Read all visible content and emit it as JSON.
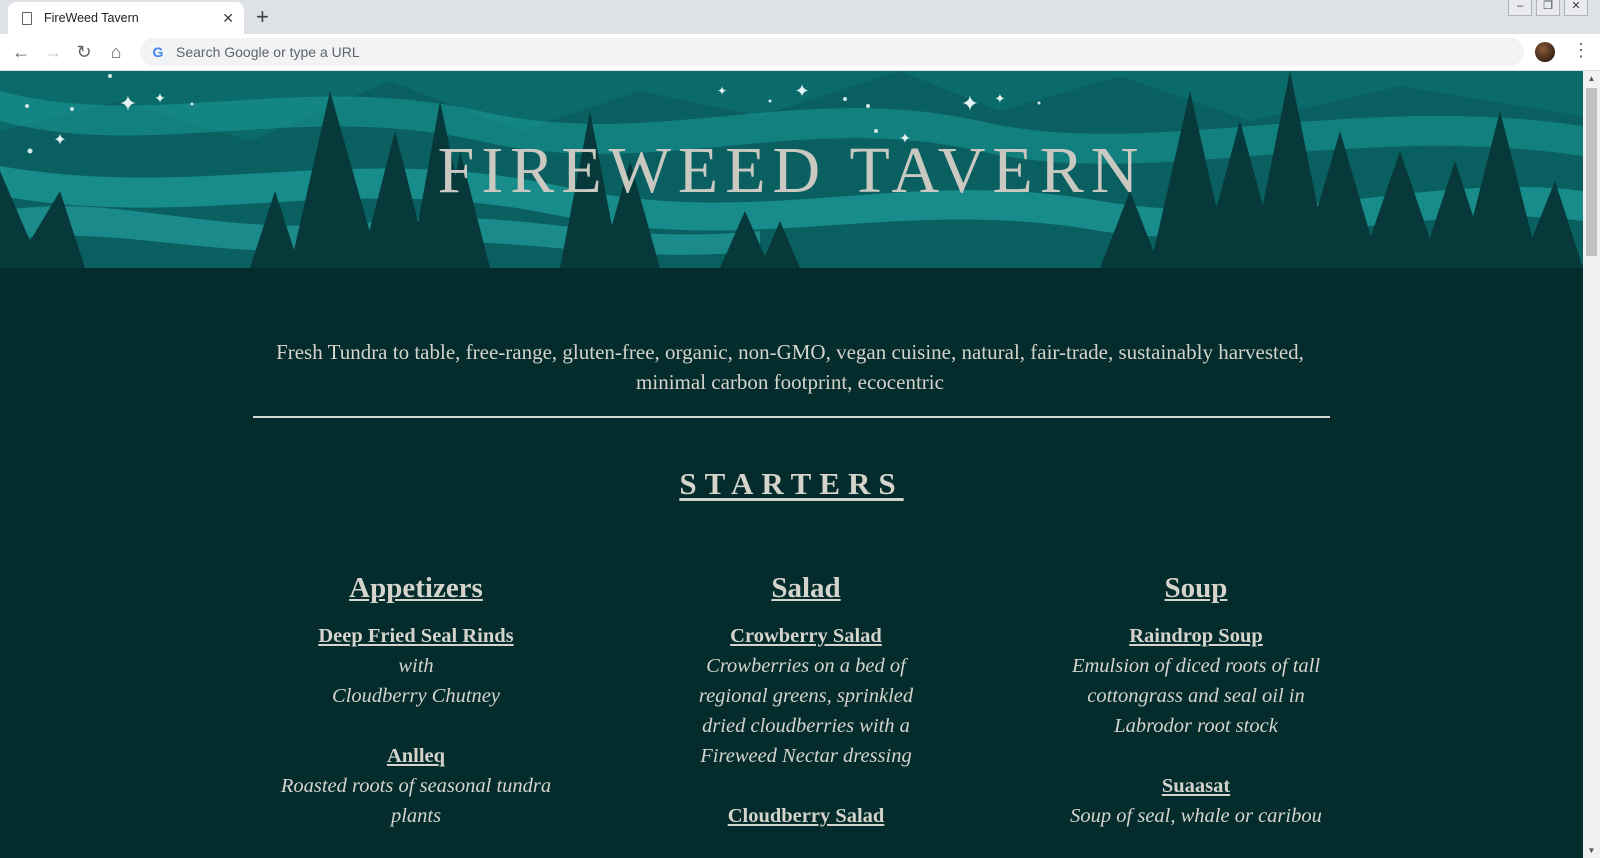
{
  "browser": {
    "tab_title": "FireWeed Tavern",
    "tab_close": "✕",
    "new_tab": "+",
    "omnibox_placeholder": "Search Google or type a URL",
    "window_controls": {
      "minimize": "–",
      "restore": "❐",
      "close": "✕"
    }
  },
  "site": {
    "title": "FIREWEED TAVERN",
    "tagline": "Fresh Tundra to table, free-range, gluten-free, organic, non-GMO, vegan cuisine, natural, fair-trade, sustainably harvested, minimal carbon footprint, ecocentric"
  },
  "menu": {
    "section_title": "STARTERS",
    "columns": [
      {
        "heading": "Appetizers",
        "items": [
          {
            "name": "Deep Fried Seal Rinds",
            "desc_line1": "with",
            "desc_line2": "Cloudberry Chutney"
          },
          {
            "name": "Anlleq",
            "desc": "Roasted roots of seasonal tundra plants"
          }
        ]
      },
      {
        "heading": "Salad",
        "items": [
          {
            "name": "Crowberry Salad",
            "desc": "Crowberries on a bed of regional greens, sprinkled dried cloudberries with a Fireweed Nectar dressing"
          },
          {
            "name": "Cloudberry Salad"
          }
        ]
      },
      {
        "heading": "Soup",
        "items": [
          {
            "name": "Raindrop Soup",
            "desc": "Emulsion of diced roots of tall cottongrass and seal oil in Labrodor root stock"
          },
          {
            "name": "Suaasat",
            "desc": "Soup of seal, whale or caribou"
          }
        ]
      }
    ]
  },
  "colors": {
    "page_background": "#042c2c",
    "text": "#d4d4cc",
    "hero_sky": "#0b6a6a",
    "hero_aurora": "#1fa3a3",
    "hero_trees": "#07393a"
  },
  "icons": [
    "page-icon",
    "back-icon",
    "forward-icon",
    "reload-icon",
    "home-icon",
    "google-icon",
    "more-menu-icon"
  ]
}
